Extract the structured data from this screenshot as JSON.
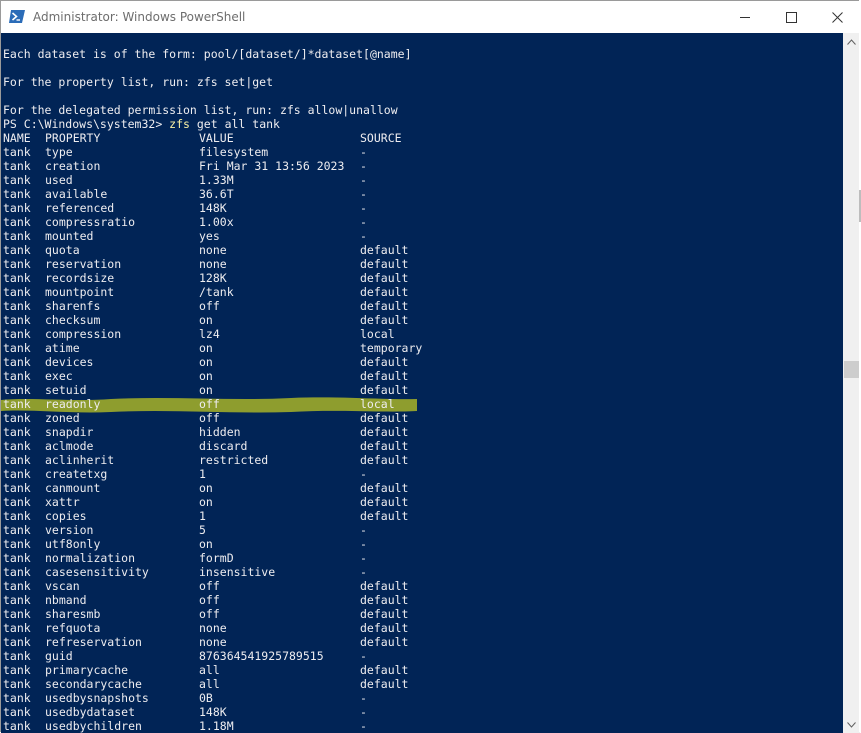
{
  "window": {
    "title": "Administrator: Windows PowerShell",
    "colors": {
      "console_bg": "#012456",
      "console_fg": "#eeedf0",
      "command": "#f9f1a5",
      "highlight": "#9aa82a"
    }
  },
  "console": {
    "intro": [
      "Each dataset is of the form: pool/[dataset/]*dataset[@name]",
      "",
      "For the property list, run: zfs set|get",
      "",
      "For the delegated permission list, run: zfs allow|unallow"
    ],
    "prompt": {
      "path": "PS C:\\Windows\\system32> ",
      "command": "zfs",
      "args": " get all tank"
    },
    "headers": {
      "name": "NAME",
      "property": "PROPERTY",
      "value": "VALUE",
      "source": "SOURCE"
    },
    "rows": [
      {
        "name": "tank",
        "property": "type",
        "value": "filesystem",
        "source": "-"
      },
      {
        "name": "tank",
        "property": "creation",
        "value": "Fri Mar 31 13:56 2023",
        "source": "-"
      },
      {
        "name": "tank",
        "property": "used",
        "value": "1.33M",
        "source": "-"
      },
      {
        "name": "tank",
        "property": "available",
        "value": "36.6T",
        "source": "-"
      },
      {
        "name": "tank",
        "property": "referenced",
        "value": "148K",
        "source": "-"
      },
      {
        "name": "tank",
        "property": "compressratio",
        "value": "1.00x",
        "source": "-"
      },
      {
        "name": "tank",
        "property": "mounted",
        "value": "yes",
        "source": "-"
      },
      {
        "name": "tank",
        "property": "quota",
        "value": "none",
        "source": "default"
      },
      {
        "name": "tank",
        "property": "reservation",
        "value": "none",
        "source": "default"
      },
      {
        "name": "tank",
        "property": "recordsize",
        "value": "128K",
        "source": "default"
      },
      {
        "name": "tank",
        "property": "mountpoint",
        "value": "/tank",
        "source": "default"
      },
      {
        "name": "tank",
        "property": "sharenfs",
        "value": "off",
        "source": "default"
      },
      {
        "name": "tank",
        "property": "checksum",
        "value": "on",
        "source": "default"
      },
      {
        "name": "tank",
        "property": "compression",
        "value": "lz4",
        "source": "local"
      },
      {
        "name": "tank",
        "property": "atime",
        "value": "on",
        "source": "temporary"
      },
      {
        "name": "tank",
        "property": "devices",
        "value": "on",
        "source": "default"
      },
      {
        "name": "tank",
        "property": "exec",
        "value": "on",
        "source": "default"
      },
      {
        "name": "tank",
        "property": "setuid",
        "value": "on",
        "source": "default"
      },
      {
        "name": "tank",
        "property": "readonly",
        "value": "off",
        "source": "local"
      },
      {
        "name": "tank",
        "property": "zoned",
        "value": "off",
        "source": "default"
      },
      {
        "name": "tank",
        "property": "snapdir",
        "value": "hidden",
        "source": "default"
      },
      {
        "name": "tank",
        "property": "aclmode",
        "value": "discard",
        "source": "default"
      },
      {
        "name": "tank",
        "property": "aclinherit",
        "value": "restricted",
        "source": "default"
      },
      {
        "name": "tank",
        "property": "createtxg",
        "value": "1",
        "source": "-"
      },
      {
        "name": "tank",
        "property": "canmount",
        "value": "on",
        "source": "default"
      },
      {
        "name": "tank",
        "property": "xattr",
        "value": "on",
        "source": "default"
      },
      {
        "name": "tank",
        "property": "copies",
        "value": "1",
        "source": "default"
      },
      {
        "name": "tank",
        "property": "version",
        "value": "5",
        "source": "-"
      },
      {
        "name": "tank",
        "property": "utf8only",
        "value": "on",
        "source": "-"
      },
      {
        "name": "tank",
        "property": "normalization",
        "value": "formD",
        "source": "-"
      },
      {
        "name": "tank",
        "property": "casesensitivity",
        "value": "insensitive",
        "source": "-"
      },
      {
        "name": "tank",
        "property": "vscan",
        "value": "off",
        "source": "default"
      },
      {
        "name": "tank",
        "property": "nbmand",
        "value": "off",
        "source": "default"
      },
      {
        "name": "tank",
        "property": "sharesmb",
        "value": "off",
        "source": "default"
      },
      {
        "name": "tank",
        "property": "refquota",
        "value": "none",
        "source": "default"
      },
      {
        "name": "tank",
        "property": "refreservation",
        "value": "none",
        "source": "default"
      },
      {
        "name": "tank",
        "property": "guid",
        "value": "876364541925789515",
        "source": "-"
      },
      {
        "name": "tank",
        "property": "primarycache",
        "value": "all",
        "source": "default"
      },
      {
        "name": "tank",
        "property": "secondarycache",
        "value": "all",
        "source": "default"
      },
      {
        "name": "tank",
        "property": "usedbysnapshots",
        "value": "0B",
        "source": "-"
      },
      {
        "name": "tank",
        "property": "usedbydataset",
        "value": "148K",
        "source": "-"
      },
      {
        "name": "tank",
        "property": "usedbychildren",
        "value": "1.18M",
        "source": "-"
      }
    ]
  }
}
